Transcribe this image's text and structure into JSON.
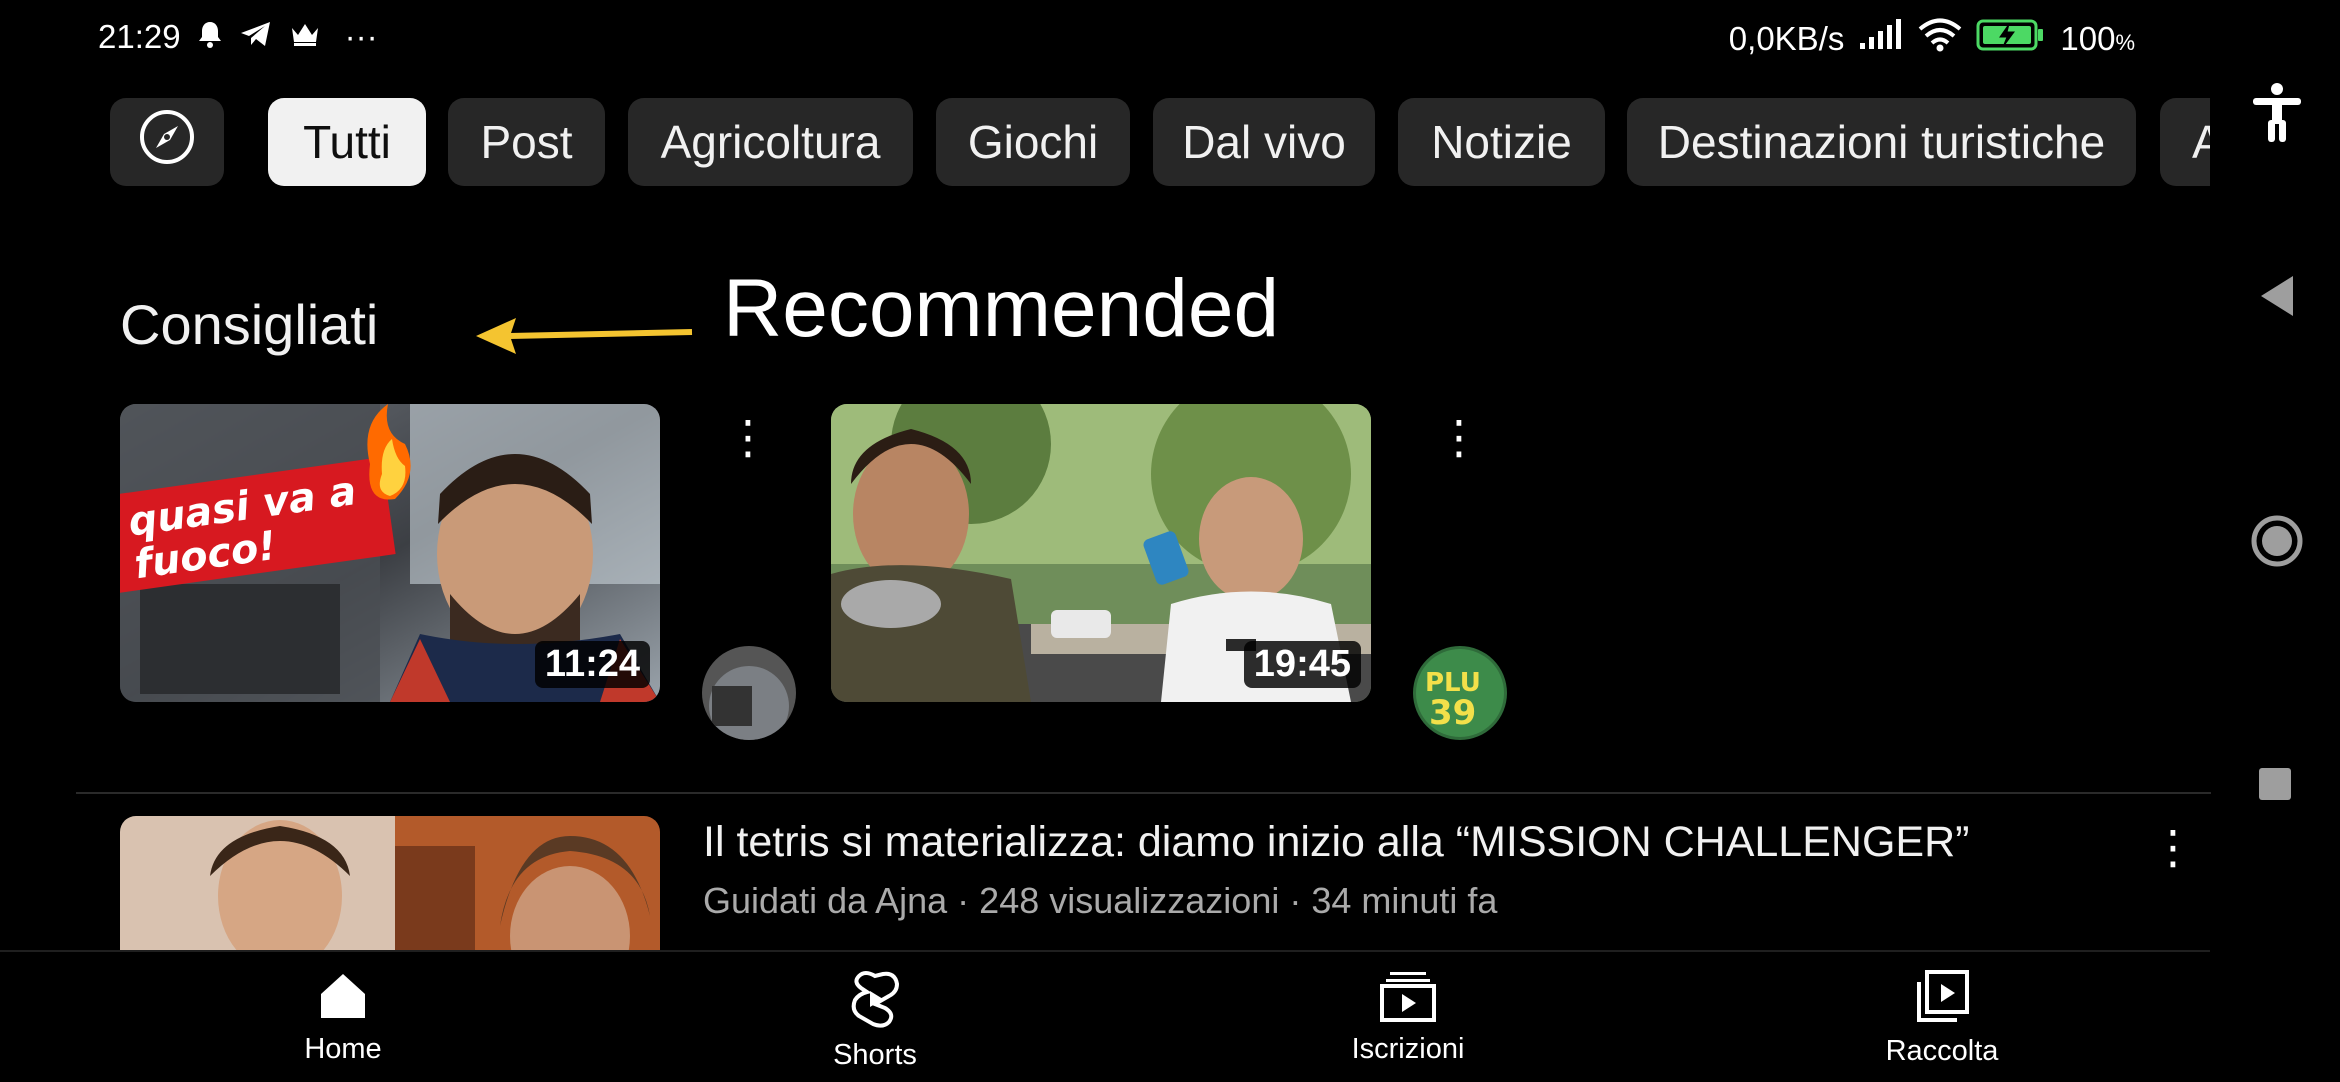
{
  "status_bar": {
    "time": "21:29",
    "more": "···",
    "net_speed": "0,0KB/s",
    "battery_value": "100",
    "battery_unit": "%"
  },
  "chips": [
    {
      "label": "Tutti",
      "active": true
    },
    {
      "label": "Post"
    },
    {
      "label": "Agricoltura"
    },
    {
      "label": "Giochi"
    },
    {
      "label": "Dal vivo"
    },
    {
      "label": "Notizie"
    },
    {
      "label": "Destinazioni turistiche"
    },
    {
      "label": "A"
    }
  ],
  "section": {
    "title": "Consigliati",
    "annotation": "Recommended"
  },
  "recommended": [
    {
      "thumb_text": "quasi va a fuoco!",
      "duration": "11:24"
    },
    {
      "duration": "19:45",
      "avatar_text": "PLU 39"
    }
  ],
  "video": {
    "title": "Il tetris si materializza: diamo inizio alla “MISSION CHALLENGER”",
    "meta": "Guidati da Ajna · 248 visualizzazioni · 34 minuti fa"
  },
  "bottom_nav": [
    {
      "label": "Home",
      "icon": "home-icon"
    },
    {
      "label": "Shorts",
      "icon": "shorts-icon"
    },
    {
      "label": "Iscrizioni",
      "icon": "subscriptions-icon"
    },
    {
      "label": "Raccolta",
      "icon": "library-icon"
    }
  ],
  "colors": {
    "background": "#000000",
    "chip": "#272727",
    "chip_active": "#f1f1f1",
    "meta_text": "#aaaaaa",
    "annotation_arrow": "#f4c430"
  }
}
